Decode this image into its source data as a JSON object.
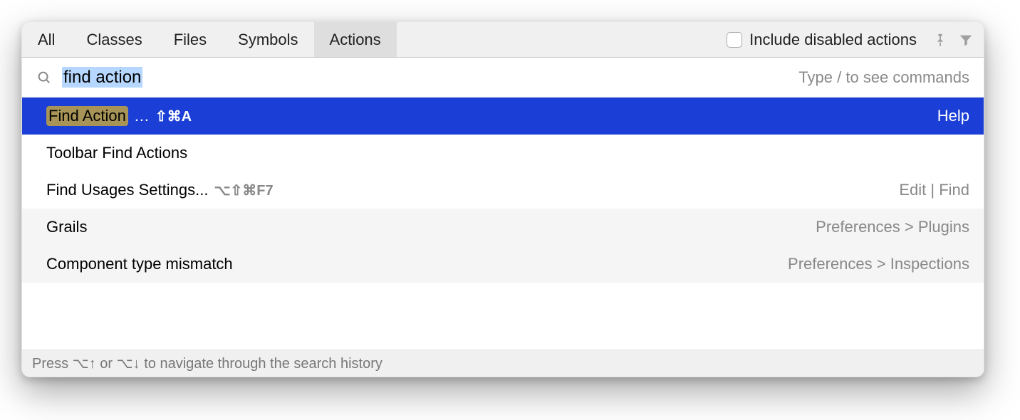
{
  "tabs": [
    {
      "label": "All"
    },
    {
      "label": "Classes"
    },
    {
      "label": "Files"
    },
    {
      "label": "Symbols"
    },
    {
      "label": "Actions",
      "active": true
    }
  ],
  "include_disabled_label": "Include disabled actions",
  "search": {
    "query": "find action",
    "hint": "Type / to see commands"
  },
  "results": [
    {
      "label": "Find Action",
      "ellipsis": "…",
      "shortcut": "⇧⌘A",
      "location": "Help",
      "selected": true,
      "highlight": true
    },
    {
      "label": "Toolbar Find Actions",
      "location": ""
    },
    {
      "label": "Find Usages Settings...",
      "shortcut": "⌥⇧⌘F7",
      "location": "Edit | Find"
    },
    {
      "label": "Grails",
      "location": "Preferences > Plugins",
      "dim": true
    },
    {
      "label": "Component type mismatch",
      "location": "Preferences > Inspections",
      "dim": true
    }
  ],
  "footer": "Press ⌥↑ or ⌥↓ to navigate through the search history"
}
